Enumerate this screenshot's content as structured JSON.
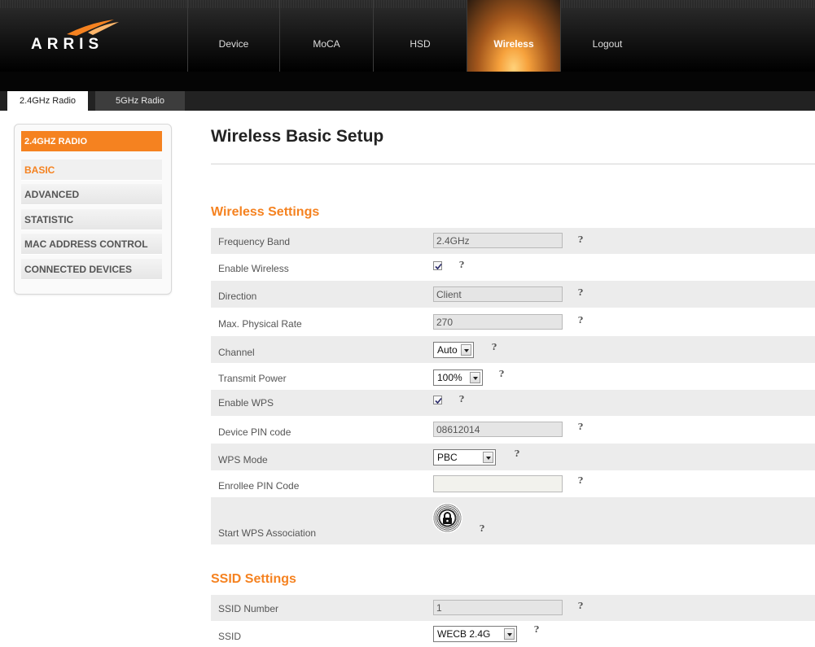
{
  "brand": {
    "name": "ARRIS"
  },
  "nav": {
    "items": [
      "Device",
      "MoCA",
      "HSD",
      "Wireless",
      "Logout"
    ],
    "active": "Wireless"
  },
  "tabs": [
    "2.4GHz Radio",
    "5GHz Radio"
  ],
  "sidebar": {
    "header": "2.4GHZ RADIO",
    "items": [
      "BASIC",
      "ADVANCED",
      "STATISTIC",
      "MAC ADDRESS CONTROL",
      "CONNECTED DEVICES"
    ],
    "active": "BASIC"
  },
  "page": {
    "title": "Wireless Basic Setup"
  },
  "wireless_settings": {
    "heading": "Wireless Settings",
    "frequency_band": {
      "label": "Frequency Band",
      "value": "2.4GHz"
    },
    "enable_wireless": {
      "label": "Enable Wireless",
      "checked": true
    },
    "direction": {
      "label": "Direction",
      "value": "Client"
    },
    "max_rate": {
      "label": "Max. Physical Rate",
      "value": "270"
    },
    "channel": {
      "label": "Channel",
      "value": "Auto"
    },
    "transmit_power": {
      "label": "Transmit Power",
      "value": "100%"
    },
    "enable_wps": {
      "label": "Enable WPS",
      "checked": true
    },
    "device_pin": {
      "label": "Device PIN code",
      "value": "08612014"
    },
    "wps_mode": {
      "label": "WPS Mode",
      "value": "PBC"
    },
    "enrollee_pin": {
      "label": "Enrollee PIN Code",
      "value": ""
    },
    "start_wps": {
      "label": "Start WPS Association"
    }
  },
  "ssid_settings": {
    "heading": "SSID Settings",
    "ssid_number": {
      "label": "SSID Number",
      "value": "1"
    },
    "ssid": {
      "label": "SSID",
      "value": "WECB 2.4G"
    }
  },
  "help_glyph": "?",
  "colors": {
    "accent": "#f58220",
    "row_shade": "#ececec"
  },
  "icons": {
    "help": "question-mark-icon",
    "wps": "lock-icon",
    "checkbox": "checkmark-icon"
  }
}
